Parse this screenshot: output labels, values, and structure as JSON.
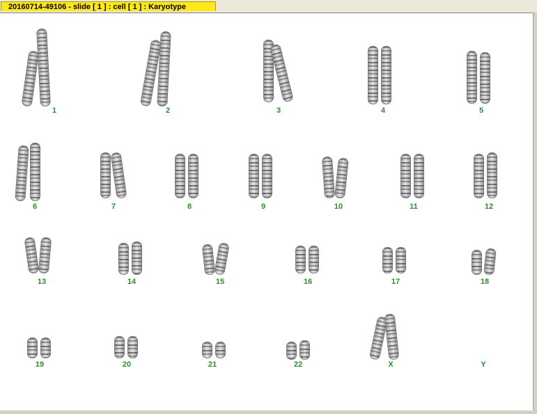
{
  "window": {
    "tab_title": "20160714-49106 - slide [ 1 ] : cell [ 1 ] : Karyotype"
  },
  "karyotype": {
    "label_color": "#2e8b2e",
    "labels": {
      "c1": "1",
      "c2": "2",
      "c3": "3",
      "c4": "4",
      "c5": "5",
      "c6": "6",
      "c7": "7",
      "c8": "8",
      "c9": "9",
      "c10": "10",
      "c11": "11",
      "c12": "12",
      "c13": "13",
      "c14": "14",
      "c15": "15",
      "c16": "16",
      "c17": "17",
      "c18": "18",
      "c19": "19",
      "c20": "20",
      "c21": "21",
      "c22": "22",
      "cX": "X",
      "cY": "Y"
    }
  }
}
